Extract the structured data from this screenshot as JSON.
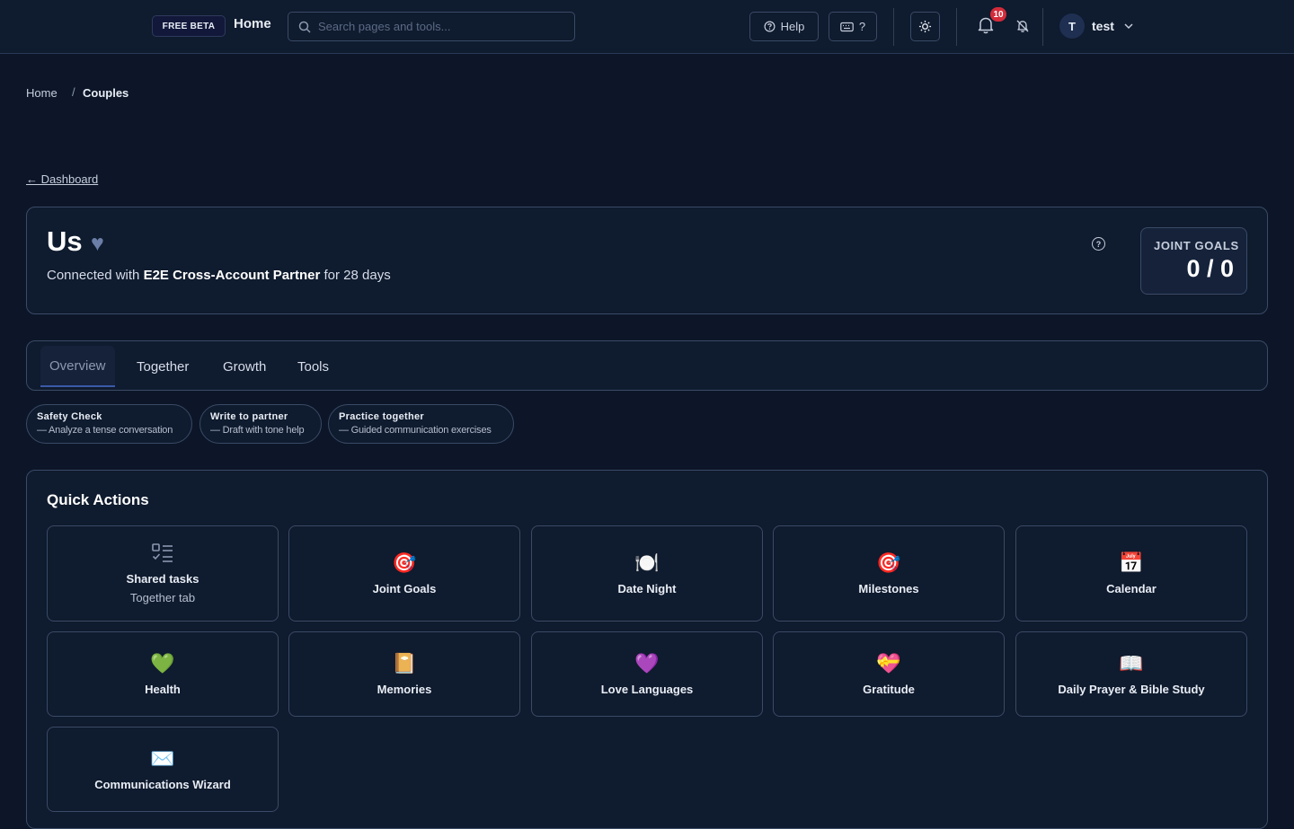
{
  "topbar": {
    "beta_badge": "FREE BETA",
    "home_label": "Home",
    "search_placeholder": "Search pages and tools...",
    "help_label": "Help",
    "shortcuts_label": "?",
    "notification_count": "10",
    "user_initial": "T",
    "username": "test"
  },
  "breadcrumb": {
    "home": "Home",
    "separator": "/",
    "current": "Couples"
  },
  "back_link": "← Dashboard",
  "header": {
    "title": "Us",
    "heart": "♥",
    "connected_prefix": "Connected with ",
    "partner_name": "E2E Cross-Account Partner",
    "connected_suffix": " for 28 days",
    "goals_label": "JOINT GOALS",
    "goals_value": "0 / 0"
  },
  "tabs": [
    {
      "label": "Overview",
      "active": true
    },
    {
      "label": "Together"
    },
    {
      "label": "Growth"
    },
    {
      "label": "Tools"
    }
  ],
  "chips": [
    {
      "title": "Safety Check",
      "subtitle": "— Analyze a tense conversation"
    },
    {
      "title": "Write to partner",
      "subtitle": "— Draft with tone help"
    },
    {
      "title": "Practice together",
      "subtitle": "— Guided communication exercises"
    }
  ],
  "quick_actions": {
    "title": "Quick Actions",
    "items": [
      {
        "label": "Shared tasks",
        "sublabel": "Together tab",
        "icon": "checklist-icon"
      },
      {
        "label": "Joint Goals",
        "glyph": "🎯",
        "icon": "target-icon"
      },
      {
        "label": "Date Night",
        "glyph": "🍽️",
        "icon": "plate-icon"
      },
      {
        "label": "Milestones",
        "glyph": "🎯",
        "icon": "target-icon"
      },
      {
        "label": "Calendar",
        "glyph": "📅",
        "icon": "calendar-icon"
      },
      {
        "label": "Health",
        "glyph": "💚",
        "icon": "green-heart-icon"
      },
      {
        "label": "Memories",
        "glyph": "📔",
        "icon": "notebook-icon"
      },
      {
        "label": "Love Languages",
        "glyph": "💜",
        "icon": "purple-heart-icon"
      },
      {
        "label": "Gratitude",
        "glyph": "💝",
        "icon": "heart-ribbon-icon"
      },
      {
        "label": "Daily Prayer & Bible Study",
        "glyph": "📖",
        "icon": "open-book-icon"
      },
      {
        "label": "Communications Wizard",
        "glyph": "✉️",
        "icon": "envelope-icon"
      }
    ]
  },
  "colors": {
    "background": "#0c1628",
    "panel": "#0f1b2e",
    "border": "#3a4a66",
    "badge": "#d42b3a"
  }
}
